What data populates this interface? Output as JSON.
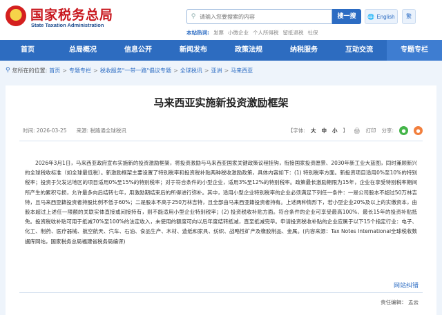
{
  "header": {
    "site_title": "国家税务总局",
    "site_subtitle": "State Taxation Administration",
    "emblem_glyph": "★",
    "search": {
      "placeholder": "请输入您要搜索的内容",
      "button": "搜一搜",
      "icon": "search-icon"
    },
    "english_label": "English",
    "traditional_label": "繁",
    "hot_label": "本站热词:",
    "hot_words": [
      "发票",
      "小微企业",
      "个人所得税",
      "留抵退税",
      "社保"
    ]
  },
  "nav": [
    "首页",
    "总局概况",
    "信息公开",
    "新闻发布",
    "政策法规",
    "纳税服务",
    "互动交流",
    "专题专栏"
  ],
  "breadcrumb": {
    "label": "您所在的位置:",
    "items": [
      "首页",
      "专题专栏",
      "税收服务\"一带一路\"倡议专题",
      "全球税讯",
      "亚洲",
      "马来西亚"
    ]
  },
  "article": {
    "title": "马来西亚实施新投资激励框架",
    "time": "时间: 2026-03-25",
    "source": "来源: 税路通全球税讯",
    "font_size_label": "【字体:",
    "font_sizes": [
      "大",
      "中",
      "小"
    ],
    "font_size_end": "】",
    "print_label": "打印",
    "share_label": "分享:",
    "body": "2026年3月1日，马来西亚政府宣布实施新的投资激励框架，将投资激励与马来西亚国家关键政策议程挂钩，衔接国家投资愿景、2030年新工业大蓝图，同时兼顾新兴的全球税收标准（如全球最低税）。新激励框架主要设置了特别税率和投资税补贴两种税收激励政策，具体内容如下：(1) 特别税率方面。新投资项目适用0%至10%的特别税率；投资于欠发达地区的项目适用0%至15%的特别税率；对于符合条件的小型企业，适用3%至12%的特别税率。政策最长激励期限为15年，企业在享受特别税率期间所产生的累积亏损，允许最多向后结转七年，用激励期结束后的所得进行弥补。其中，适用小型企业特别税率的企业必须满足下列任一条件：一是公司股本不超过50万林吉特，且马来西亚籍投资者持股比例不低于60%；二是股本不高于250万林吉特，且全部由马来西亚籍投资者持有。上述两种情形下，若小型企业20%及以上的实缴资本，由股本超过上述任一限额的关联实体直接或间接持有，则不能适用小型企业特别税率；(2) 投资税收补贴方面。符合条件的企业可享受最高100%、最长15年的投资补贴抵免。投资税收补贴可用于抵减70%至100%的法定收入，未使用的额度可向以后年度结转抵减，直至抵减完毕。申请投资税收补贴的企业应属于以下15个指定行业：电子、化工、制药、医疗器械、航空航天、汽车、石油、食品生产、木材、造纸和家具、纺织、战略性矿产及橡胶制品、金属。(内容来源：Tax Notes International全球税收数据库网站，国家税务总局福建省税务局编译)",
    "error_link": "网站纠错",
    "editor": "责任编辑：  孟云"
  },
  "colors": {
    "brand_red": "#c8161d",
    "nav_blue": "#2d6cc0",
    "link_blue": "#2c6cc3"
  }
}
